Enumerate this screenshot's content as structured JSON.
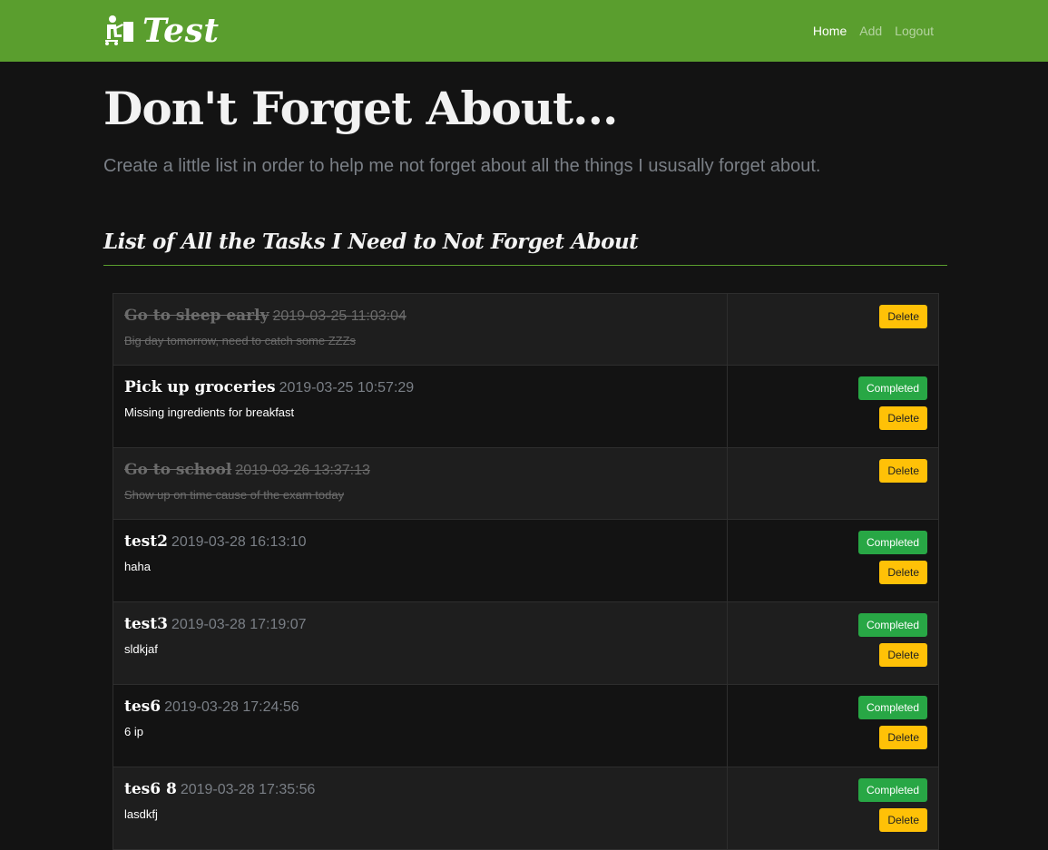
{
  "nav": {
    "brand": "Test",
    "brand_icon": "person-at-desk-icon",
    "links": [
      {
        "label": "Home",
        "active": true
      },
      {
        "label": "Add",
        "active": false
      },
      {
        "label": "Logout",
        "active": false
      }
    ]
  },
  "jumbotron": {
    "title": "Don't Forget About...",
    "lead": "Create a little list in order to help me not forget about all the things I ususally forget about."
  },
  "section": {
    "title": "List of All the Tasks I Need to Not Forget About"
  },
  "tasks": [
    {
      "name": "Go to sleep early",
      "date": "2019-03-25 11:03:04",
      "description": "Big day tomorrow, need to catch some ZZZs",
      "completed": true,
      "show_completed_button": false
    },
    {
      "name": "Pick up groceries",
      "date": "2019-03-25 10:57:29",
      "description": "Missing ingredients for breakfast",
      "completed": false,
      "show_completed_button": true
    },
    {
      "name": "Go to school",
      "date": "2019-03-26 13:37:13",
      "description": "Show up on time cause of the exam today",
      "completed": true,
      "show_completed_button": false
    },
    {
      "name": "test2",
      "date": "2019-03-28 16:13:10",
      "description": "haha",
      "completed": false,
      "show_completed_button": true
    },
    {
      "name": "test3",
      "date": "2019-03-28 17:19:07",
      "description": "sldkjaf",
      "completed": false,
      "show_completed_button": true
    },
    {
      "name": "tes6",
      "date": "2019-03-28 17:24:56",
      "description": "6 ip",
      "completed": false,
      "show_completed_button": true
    },
    {
      "name": "tes6 8",
      "date": "2019-03-28 17:35:56",
      "description": "lasdkfj",
      "completed": false,
      "show_completed_button": true
    }
  ],
  "buttons": {
    "completed_label": "Completed",
    "delete_label": "Delete"
  },
  "colors": {
    "navbar": "#5a9e2e",
    "success": "#28a745",
    "warning": "#ffc107",
    "background": "#131313"
  }
}
